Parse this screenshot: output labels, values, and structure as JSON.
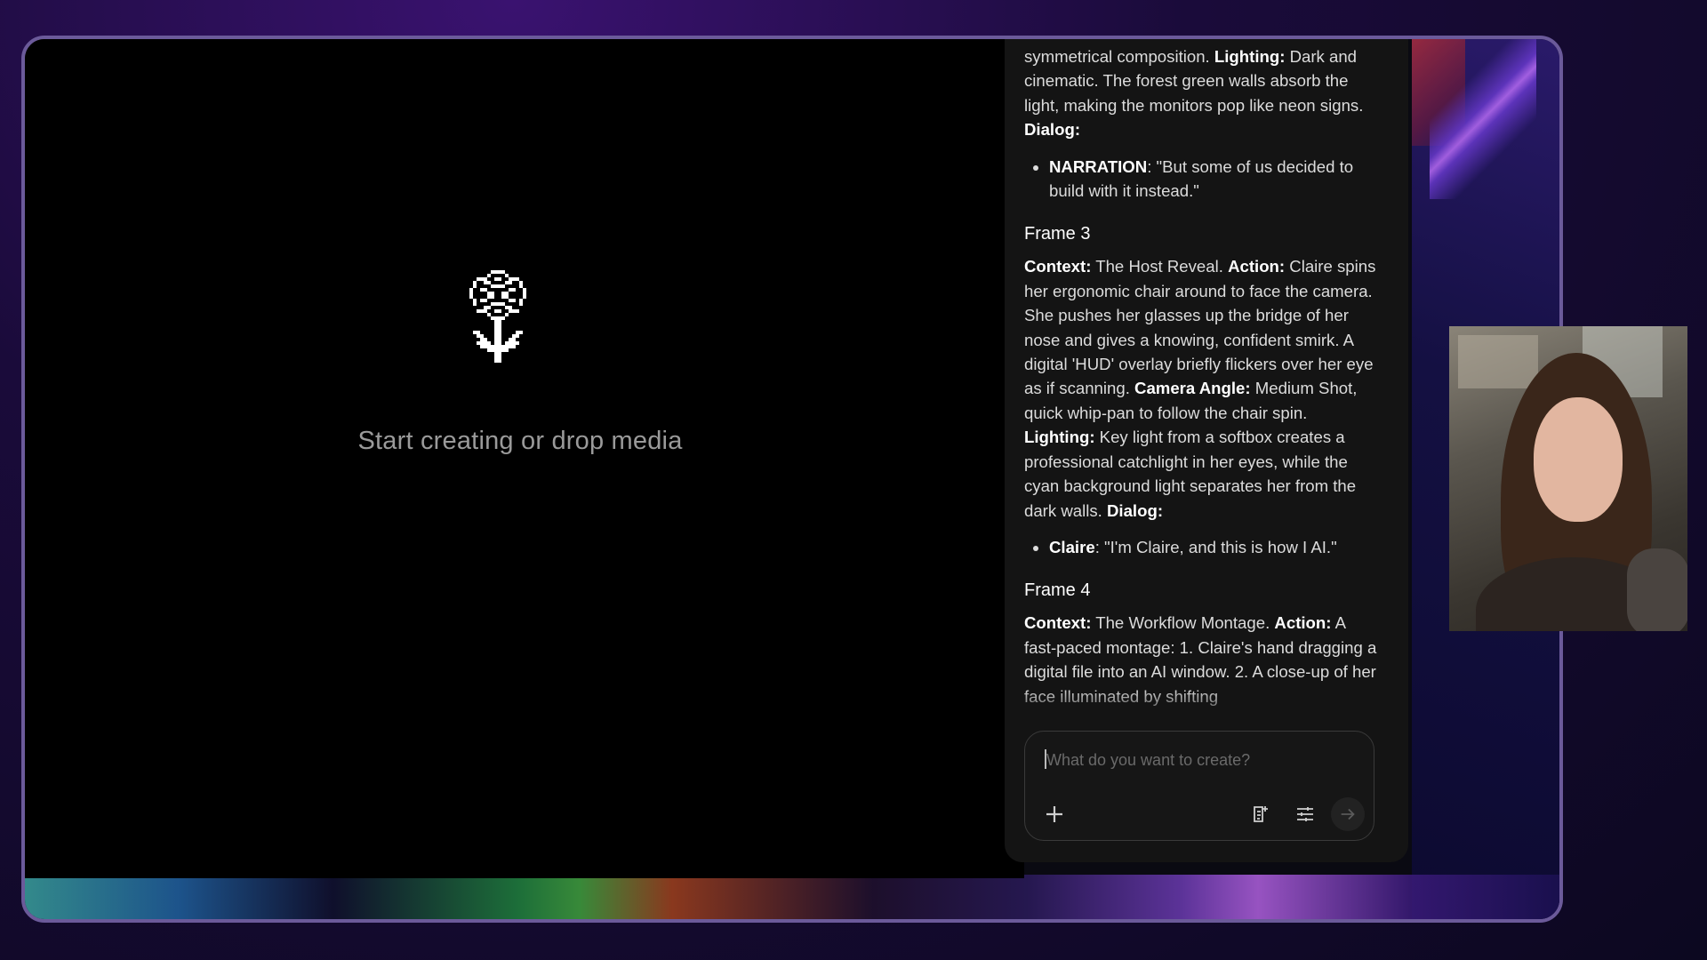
{
  "canvas": {
    "hint": "Start creating or drop media",
    "logo_icon": "pixel-flower-icon"
  },
  "panel": {
    "intro": {
      "text1": "symmetrical composition. ",
      "lighting_label": "Lighting:",
      "text2": " Dark and cinematic. The forest green walls absorb the light, making the monitors pop like neon signs. ",
      "dialog_label": "Dialog:"
    },
    "intro_bullet": {
      "speaker": "NARRATION",
      "line": ": \"But some of us decided to build with it instead.\""
    },
    "frame3": {
      "heading": "Frame 3",
      "context_label": "Context:",
      "context": " The Host Reveal. ",
      "action_label": "Action:",
      "action": " Claire spins her ergonomic chair around to face the camera. She pushes her glasses up the bridge of her nose and gives a knowing, confident smirk. A digital 'HUD' overlay briefly flickers over her eye as if scanning. ",
      "camera_label": "Camera Angle:",
      "camera": " Medium Shot, quick whip-pan to follow the chair spin. ",
      "lighting_label": "Lighting:",
      "lighting": " Key light from a softbox creates a professional catchlight in her eyes, while the cyan background light separates her from the dark walls. ",
      "dialog_label": "Dialog:",
      "bullet_speaker": "Claire",
      "bullet_line": ": \"I'm Claire, and this is how I AI.\""
    },
    "frame4": {
      "heading": "Frame 4",
      "context_label": "Context:",
      "context": " The Workflow Montage. ",
      "action_label": "Action:",
      "action": " A fast-paced montage: 1. Claire's hand dragging a digital file into an AI window. 2. A close-up of her face illuminated by shifting"
    }
  },
  "composer": {
    "placeholder": "What do you want to create?",
    "add_icon": "plus-icon",
    "doc_icon": "document-add-icon",
    "settings_icon": "sliders-icon",
    "send_icon": "arrow-right-icon"
  },
  "webcam": {
    "label": "presenter-webcam"
  }
}
